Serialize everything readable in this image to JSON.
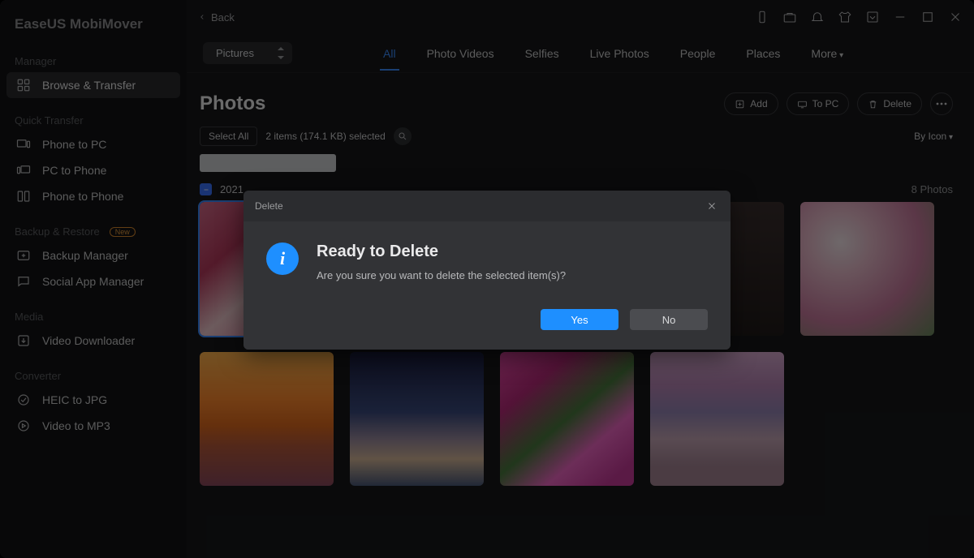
{
  "app_title": "EaseUS MobiMover",
  "sidebar": {
    "sections": [
      {
        "label": "Manager",
        "items": [
          {
            "label": "Browse & Transfer",
            "icon": "grid-icon",
            "active": true
          }
        ]
      },
      {
        "label": "Quick Transfer",
        "items": [
          {
            "label": "Phone to PC",
            "icon": "phone-pc-icon"
          },
          {
            "label": "PC to Phone",
            "icon": "pc-phone-icon"
          },
          {
            "label": "Phone to Phone",
            "icon": "phone-phone-icon"
          }
        ]
      },
      {
        "label": "Backup & Restore",
        "badge": "New",
        "items": [
          {
            "label": "Backup Manager",
            "icon": "backup-icon"
          },
          {
            "label": "Social App Manager",
            "icon": "social-icon"
          }
        ]
      },
      {
        "label": "Media",
        "items": [
          {
            "label": "Video Downloader",
            "icon": "download-icon"
          }
        ]
      },
      {
        "label": "Converter",
        "items": [
          {
            "label": "HEIC to JPG",
            "icon": "heic-icon"
          },
          {
            "label": "Video to MP3",
            "icon": "mp3-icon"
          }
        ]
      }
    ]
  },
  "topbar": {
    "back": "Back"
  },
  "tabsbar": {
    "dropdown_value": "Pictures",
    "tabs": [
      "All",
      "Photo Videos",
      "Selfies",
      "Live Photos",
      "People",
      "Places",
      "More"
    ],
    "active_tab": "All"
  },
  "header": {
    "title": "Photos",
    "buttons": {
      "add": "Add",
      "topc": "To PC",
      "delete": "Delete"
    }
  },
  "selection": {
    "select_all": "Select All",
    "count_text": "2 items (174.1 KB) selected",
    "view_by": "By Icon"
  },
  "date_group": {
    "date": "2021",
    "photo_count": "8 Photos"
  },
  "dialog": {
    "head": "Delete",
    "title": "Ready to Delete",
    "message": "Are you sure you want to delete the selected item(s)?",
    "yes": "Yes",
    "no": "No"
  }
}
